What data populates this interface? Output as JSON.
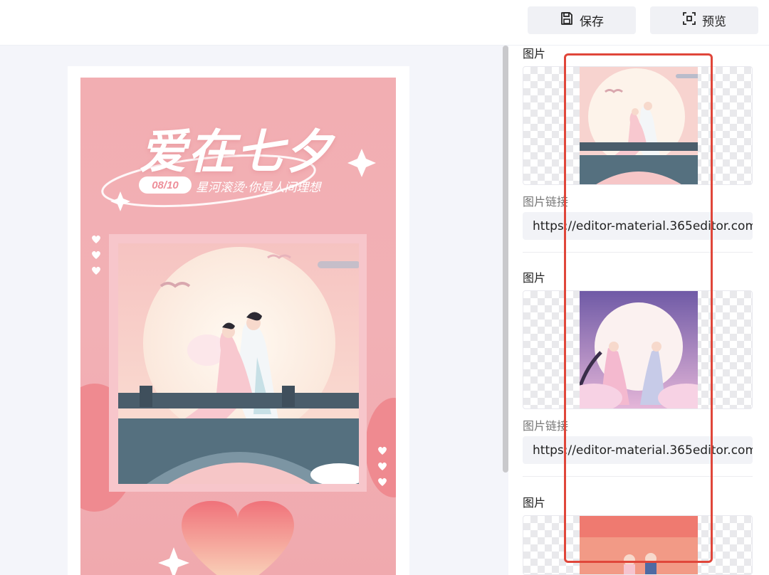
{
  "toolbar": {
    "save_label": "保存",
    "save_icon": "floppy-disk-icon",
    "preview_label": "预览",
    "preview_icon": "preview-frame-icon"
  },
  "poster": {
    "title": "爱在七夕",
    "date": "08/10",
    "subtitle": "星河滚烫·你是人间理想"
  },
  "panel": {
    "items": [
      {
        "section_label": "图片",
        "link_label": "图片链接",
        "url": "https://editor-material.365editor.com"
      },
      {
        "section_label": "图片",
        "link_label": "图片链接",
        "url": "https://editor-material.365editor.com"
      },
      {
        "section_label": "图片"
      }
    ]
  },
  "colors": {
    "poster_bg": "#f2aeb2",
    "highlight": "#e0463a",
    "button_bg": "#f0f1f5"
  }
}
